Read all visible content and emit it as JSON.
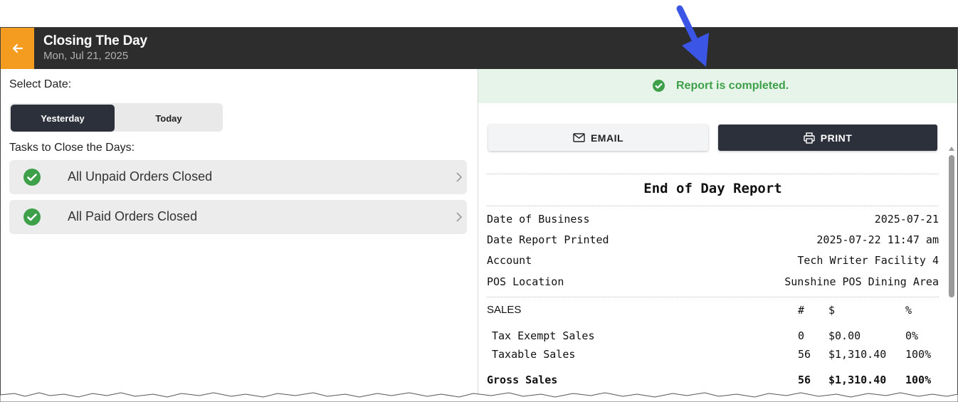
{
  "header": {
    "title": "Closing The Day",
    "subtitle": "Mon, Jul 21, 2025",
    "back_icon": "arrow-left-icon",
    "accent_color": "#f39c1f",
    "bar_color": "#2d2d2d"
  },
  "left_panel": {
    "select_date_label": "Select Date:",
    "date_options": [
      "Yesterday",
      "Today"
    ],
    "selected_date": "Yesterday",
    "tasks_label": "Tasks to Close the Days:",
    "tasks": [
      {
        "label": "All Unpaid Orders Closed",
        "status": "complete"
      },
      {
        "label": "All Paid Orders Closed",
        "status": "complete"
      }
    ]
  },
  "right_panel": {
    "banner_text": "Report is completed.",
    "banner_color": "#3fa04a",
    "email_label": "EMAIL",
    "print_label": "PRINT",
    "report": {
      "title": "End of Day Report",
      "info_rows": [
        {
          "key": "Date of Business",
          "value": "2025-07-21"
        },
        {
          "key": "Date Report Printed",
          "value": "2025-07-22 11:47 am"
        },
        {
          "key": "Account",
          "value": "Tech Writer Facility 4"
        },
        {
          "key": "POS Location",
          "value": "Sunshine POS Dining Area"
        }
      ],
      "sales_header": {
        "label": "SALES",
        "count": "#",
        "amount": "$",
        "percent": "%"
      },
      "sales_rows": [
        {
          "label": "Tax Exempt Sales",
          "count": "0",
          "amount": "$0.00",
          "percent": "0%"
        },
        {
          "label": "Taxable Sales",
          "count": "56",
          "amount": "$1,310.40",
          "percent": "100%"
        }
      ],
      "gross_row": {
        "label": "Gross Sales",
        "count": "56",
        "amount": "$1,310.40",
        "percent": "100%"
      }
    }
  },
  "annotation": {
    "arrow_color": "#3b55e6",
    "arrow_icon": "pointer-arrow-icon"
  }
}
